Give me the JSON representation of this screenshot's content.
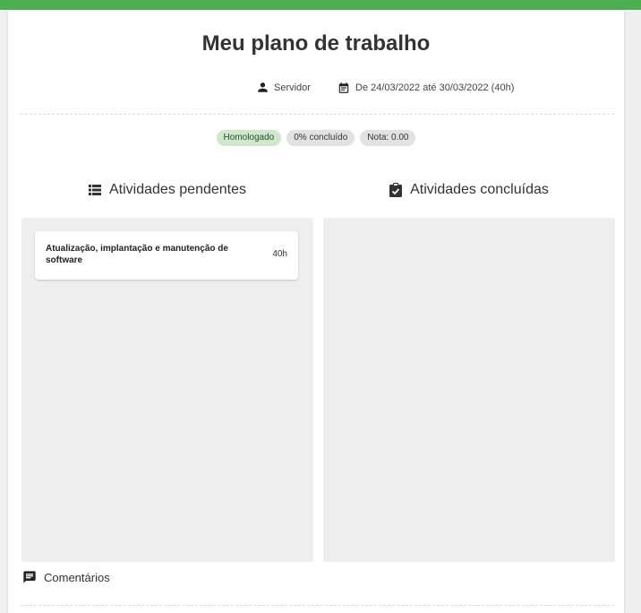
{
  "page": {
    "title": "Meu plano de trabalho",
    "role": "Servidor",
    "period": "De 24/03/2022 até 30/03/2022 (40h)"
  },
  "chips": {
    "status": "Homologado",
    "progress": "0% concluído",
    "grade": "Nota: 0.00"
  },
  "columns": {
    "pending_title": "Atividades pendentes",
    "done_title": "Atividades concluídas"
  },
  "pending_tasks": [
    {
      "name": "Atualização, implantação e manutenção de software",
      "hours": "40h"
    }
  ],
  "comments": {
    "label": "Comentários"
  },
  "colors": {
    "accent": "#4caf50",
    "chip_ok": "#cfe8cc",
    "chip_neutral": "#e2e2e2"
  },
  "icons": {
    "role": "person-icon",
    "period": "calendar-icon",
    "pending": "list-icon",
    "done": "clipboard-check-icon",
    "comments": "comment-icon"
  }
}
